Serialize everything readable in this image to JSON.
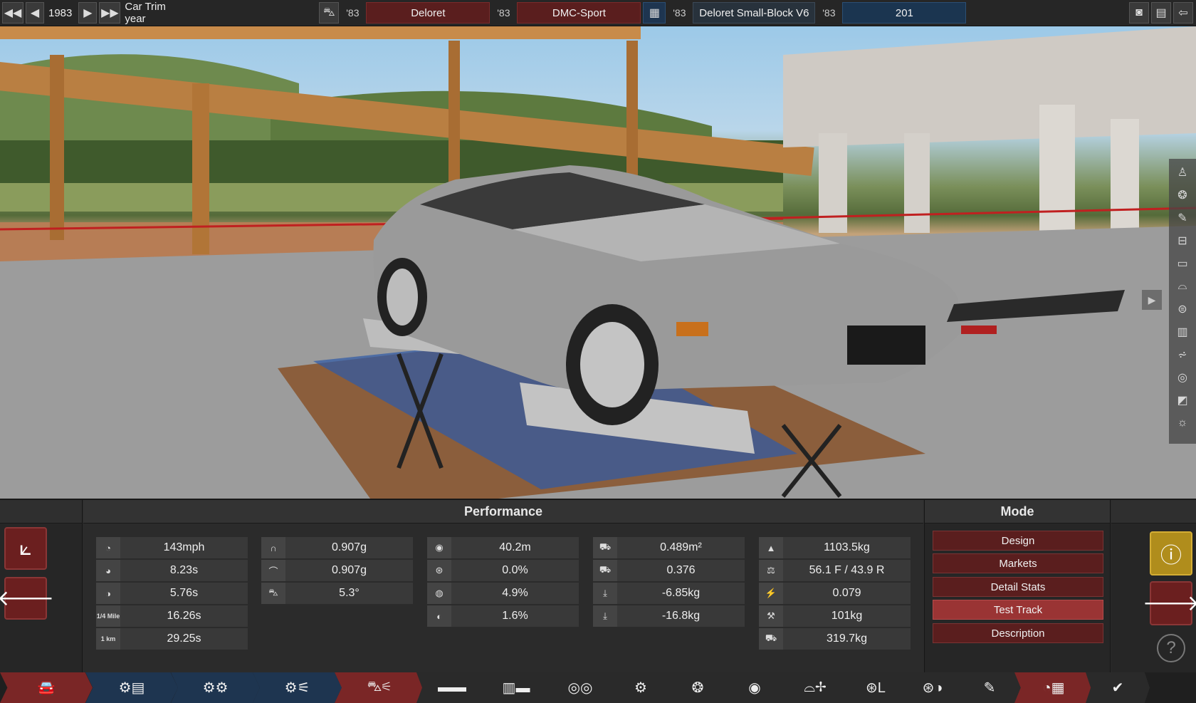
{
  "topbar": {
    "year": "1983",
    "year_label": "Car Trim year",
    "model_year": "'83",
    "model_name": "Deloret",
    "trim_year": "'83",
    "trim_name": "DMC-Sport",
    "engine_year": "'83",
    "engine_name": "Deloret Small-Block V6",
    "variant_year": "'83",
    "variant_name": "201"
  },
  "performance": {
    "title": "Performance",
    "col1": [
      "143mph",
      "8.23s",
      "5.76s",
      "16.26s",
      "29.25s"
    ],
    "col2": [
      "0.907g",
      "0.907g",
      "5.3°"
    ],
    "col3": [
      "40.2m",
      "0.0%",
      "4.9%",
      "1.6%"
    ],
    "col4": [
      "0.489m²",
      "0.376",
      "-6.85kg",
      "-16.8kg"
    ],
    "col5": [
      "1103.5kg",
      "56.1 F / 43.9 R",
      "0.079",
      "101kg",
      "319.7kg"
    ],
    "icon_labels": {
      "quarter_mile": "1/4 Mile",
      "km": "1 km"
    }
  },
  "mode": {
    "title": "Mode",
    "buttons": [
      "Design",
      "Markets",
      "Detail Stats",
      "Test Track",
      "Description"
    ],
    "active": "Test Track"
  },
  "colors": {
    "accent_red": "#6b1f1f",
    "active_red": "#9a3434",
    "engine_blue": "#1e3550",
    "warn_gold": "#b08d1c"
  }
}
